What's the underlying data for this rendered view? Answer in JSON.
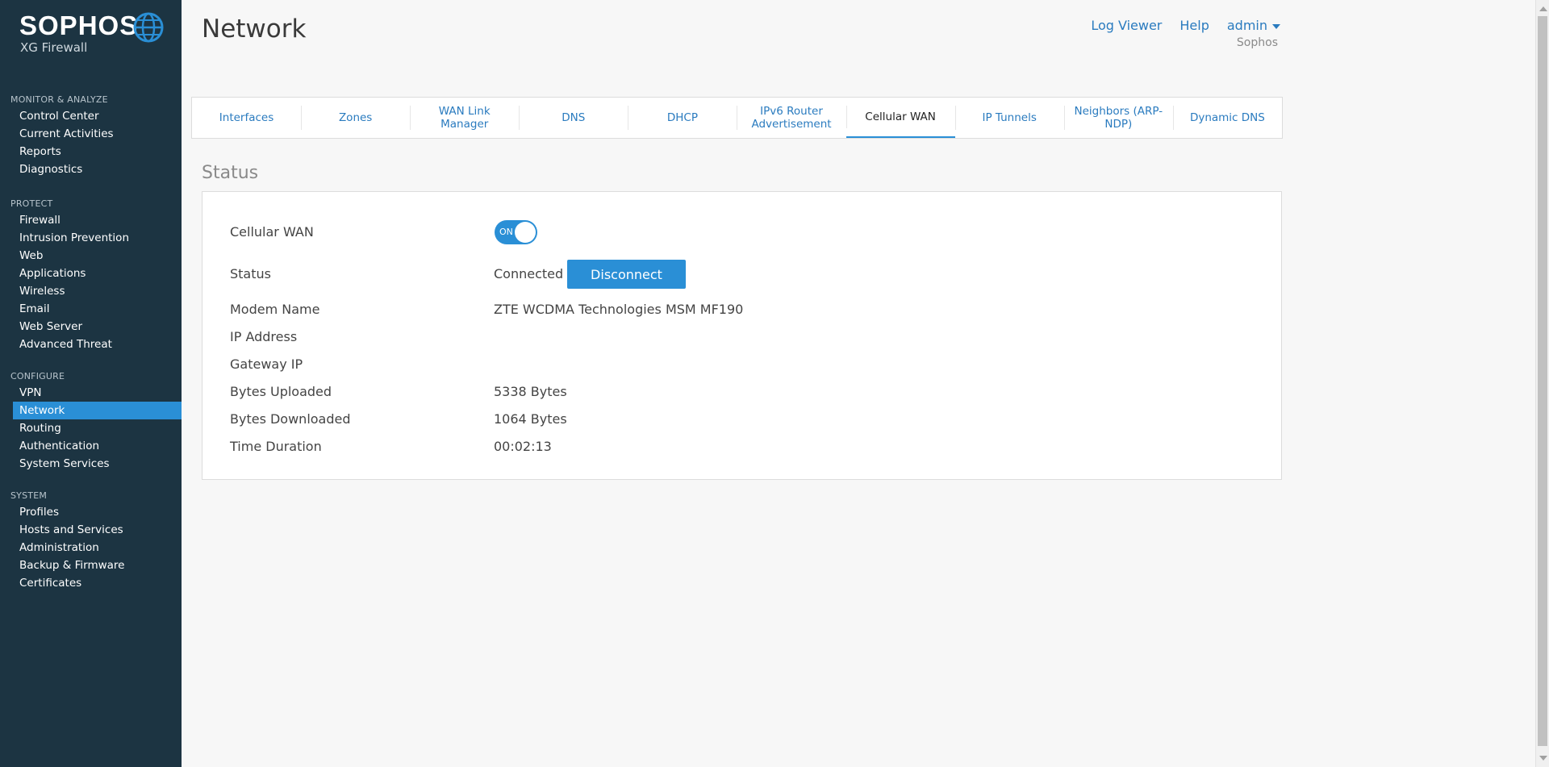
{
  "brand": {
    "name": "SOPHOS",
    "product": "XG Firewall"
  },
  "sidebar": {
    "sections": [
      {
        "heading": "MONITOR & ANALYZE",
        "items": [
          "Control Center",
          "Current Activities",
          "Reports",
          "Diagnostics"
        ]
      },
      {
        "heading": "PROTECT",
        "items": [
          "Firewall",
          "Intrusion Prevention",
          "Web",
          "Applications",
          "Wireless",
          "Email",
          "Web Server",
          "Advanced Threat"
        ]
      },
      {
        "heading": "CONFIGURE",
        "items": [
          "VPN",
          "Network",
          "Routing",
          "Authentication",
          "System Services"
        ]
      },
      {
        "heading": "SYSTEM",
        "items": [
          "Profiles",
          "Hosts and Services",
          "Administration",
          "Backup & Firmware",
          "Certificates"
        ]
      }
    ],
    "active_item": "Network"
  },
  "header": {
    "title": "Network",
    "links": {
      "log_viewer": "Log Viewer",
      "help": "Help",
      "user": "admin"
    },
    "org": "Sophos"
  },
  "tabs": {
    "items": [
      "Interfaces",
      "Zones",
      "WAN Link Manager",
      "DNS",
      "DHCP",
      "IPv6 Router Advertisement",
      "Cellular WAN",
      "IP Tunnels",
      "Neighbors (ARP-NDP)",
      "Dynamic DNS"
    ],
    "active": "Cellular WAN"
  },
  "status": {
    "section_title": "Status",
    "cellular_wan_label": "Cellular WAN",
    "toggle_label": "ON",
    "toggle_on": true,
    "status_label": "Status",
    "status_value": "Connected",
    "disconnect_label": "Disconnect",
    "modem_name_label": "Modem Name",
    "modem_name_value": "ZTE WCDMA Technologies MSM MF190",
    "ip_address_label": "IP Address",
    "ip_address_value": "",
    "gateway_ip_label": "Gateway IP",
    "gateway_ip_value": "",
    "bytes_uploaded_label": "Bytes Uploaded",
    "bytes_uploaded_value": "5338 Bytes",
    "bytes_downloaded_label": "Bytes Downloaded",
    "bytes_downloaded_value": "1064 Bytes",
    "time_duration_label": "Time Duration",
    "time_duration_value": "00:02:13"
  },
  "colors": {
    "sidebar_bg": "#1c3442",
    "accent": "#2a8fd6",
    "link": "#2a7bbf"
  }
}
